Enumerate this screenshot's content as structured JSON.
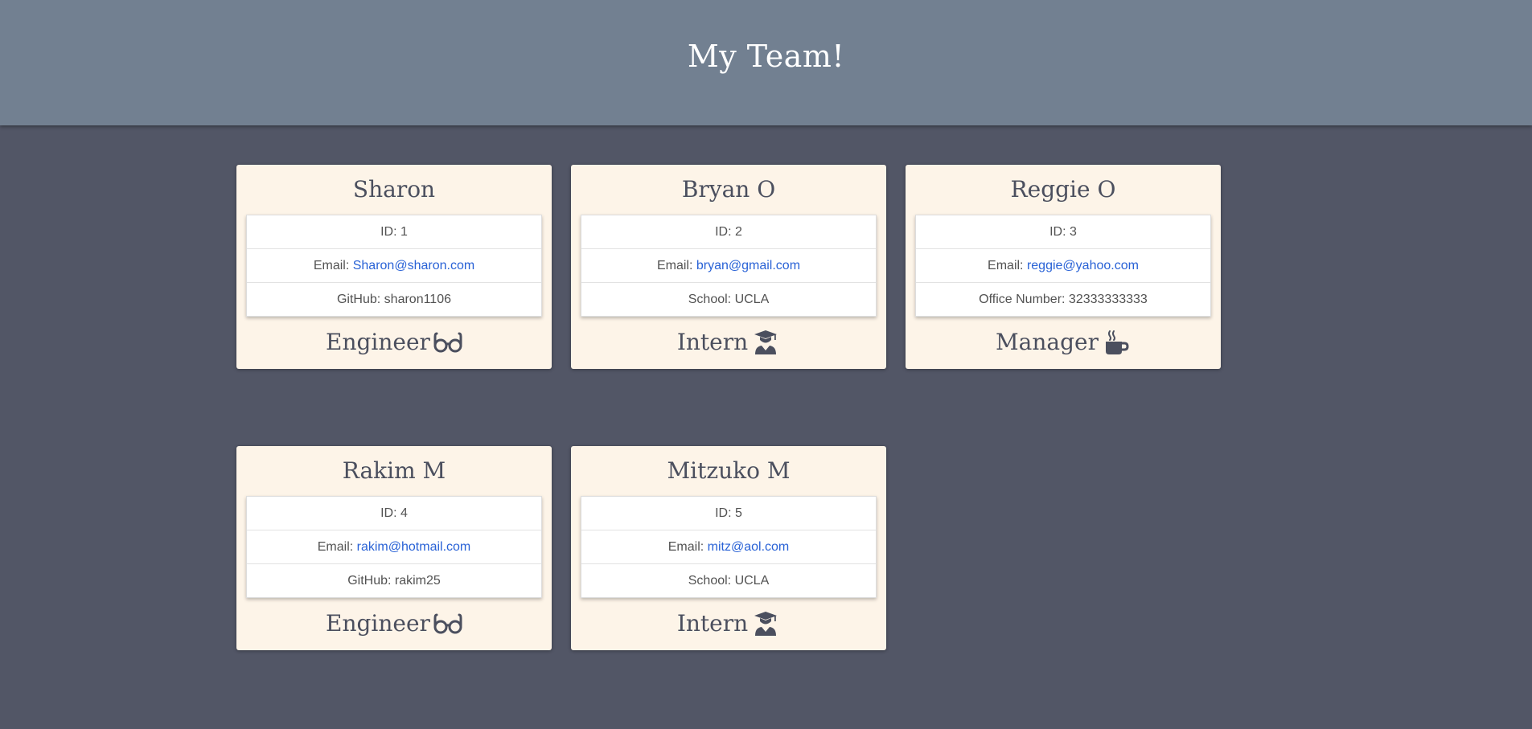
{
  "header": {
    "title": "My Team!"
  },
  "colors": {
    "background": "#525666",
    "header": "#728091",
    "card": "#fdf4e8",
    "link": "#2962d6",
    "text": "#4b4f5e"
  },
  "team": [
    {
      "name": "Sharon",
      "id_text": "ID: 1",
      "email_label": "Email: ",
      "email": "Sharon@sharon.com",
      "detail_label": "GitHub: ",
      "detail_value": "sharon1106",
      "role": "Engineer",
      "icon": "glasses-icon"
    },
    {
      "name": "Bryan O",
      "id_text": "ID: 2",
      "email_label": "Email: ",
      "email": "bryan@gmail.com",
      "detail_label": "School: ",
      "detail_value": "UCLA",
      "role": "Intern",
      "icon": "graduate-icon"
    },
    {
      "name": "Reggie O",
      "id_text": "ID: 3",
      "email_label": "Email: ",
      "email": "reggie@yahoo.com",
      "detail_label": "Office Number: ",
      "detail_value": "32333333333",
      "role": "Manager",
      "icon": "coffee-icon"
    },
    {
      "name": "Rakim M",
      "id_text": "ID: 4",
      "email_label": "Email: ",
      "email": "rakim@hotmail.com",
      "detail_label": "GitHub: ",
      "detail_value": "rakim25",
      "role": "Engineer",
      "icon": "glasses-icon"
    },
    {
      "name": "Mitzuko M",
      "id_text": "ID: 5",
      "email_label": "Email: ",
      "email": "mitz@aol.com",
      "detail_label": "School: ",
      "detail_value": "UCLA",
      "role": "Intern",
      "icon": "graduate-icon"
    }
  ]
}
